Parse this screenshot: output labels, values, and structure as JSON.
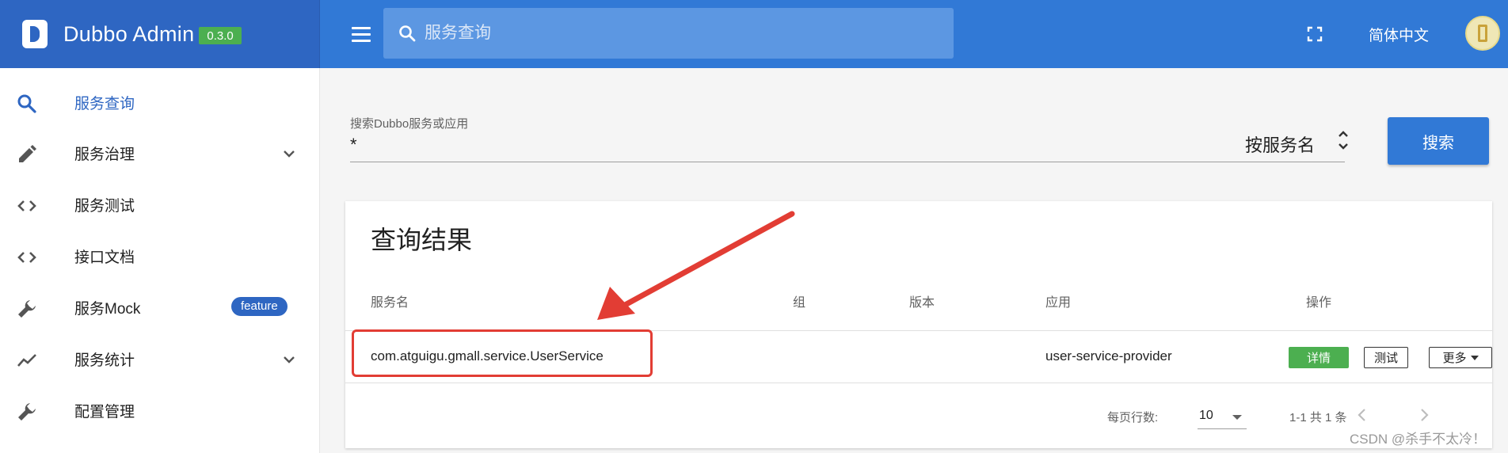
{
  "brand": {
    "title": "Dubbo Admin",
    "version": "0.3.0"
  },
  "appbar": {
    "search_placeholder": "服务查询",
    "language": "简体中文"
  },
  "sidebar": {
    "items": [
      {
        "label": "服务查询",
        "icon": "search-icon",
        "active": true
      },
      {
        "label": "服务治理",
        "icon": "pencil-icon",
        "expandable": true
      },
      {
        "label": "服务测试",
        "icon": "code-icon"
      },
      {
        "label": "接口文档",
        "icon": "code-icon"
      },
      {
        "label": "服务Mock",
        "icon": "wrench-icon",
        "badge": "feature"
      },
      {
        "label": "服务统计",
        "icon": "trending-icon",
        "expandable": true
      },
      {
        "label": "配置管理",
        "icon": "wrench-icon"
      }
    ]
  },
  "search": {
    "label": "搜索Dubbo服务或应用",
    "value": "*",
    "sort_by": "按服务名",
    "button": "搜索"
  },
  "results": {
    "title": "查询结果",
    "columns": [
      "服务名",
      "组",
      "版本",
      "应用",
      "操作"
    ],
    "rows": [
      {
        "service": "com.atguigu.gmall.service.UserService",
        "group": "",
        "version": "",
        "application": "user-service-provider",
        "actions": {
          "detail": "详情",
          "test": "测试",
          "more": "更多"
        }
      }
    ],
    "pagination": {
      "rows_per_page_label": "每页行数:",
      "rows_per_page": "10",
      "range": "1-1 共 1 条"
    }
  },
  "watermark": "CSDN @杀手不太冷！",
  "colors": {
    "brand": "#2e66c2",
    "appbar": "#3179d6",
    "success": "#4caf50",
    "annotation": "#e23d34"
  }
}
